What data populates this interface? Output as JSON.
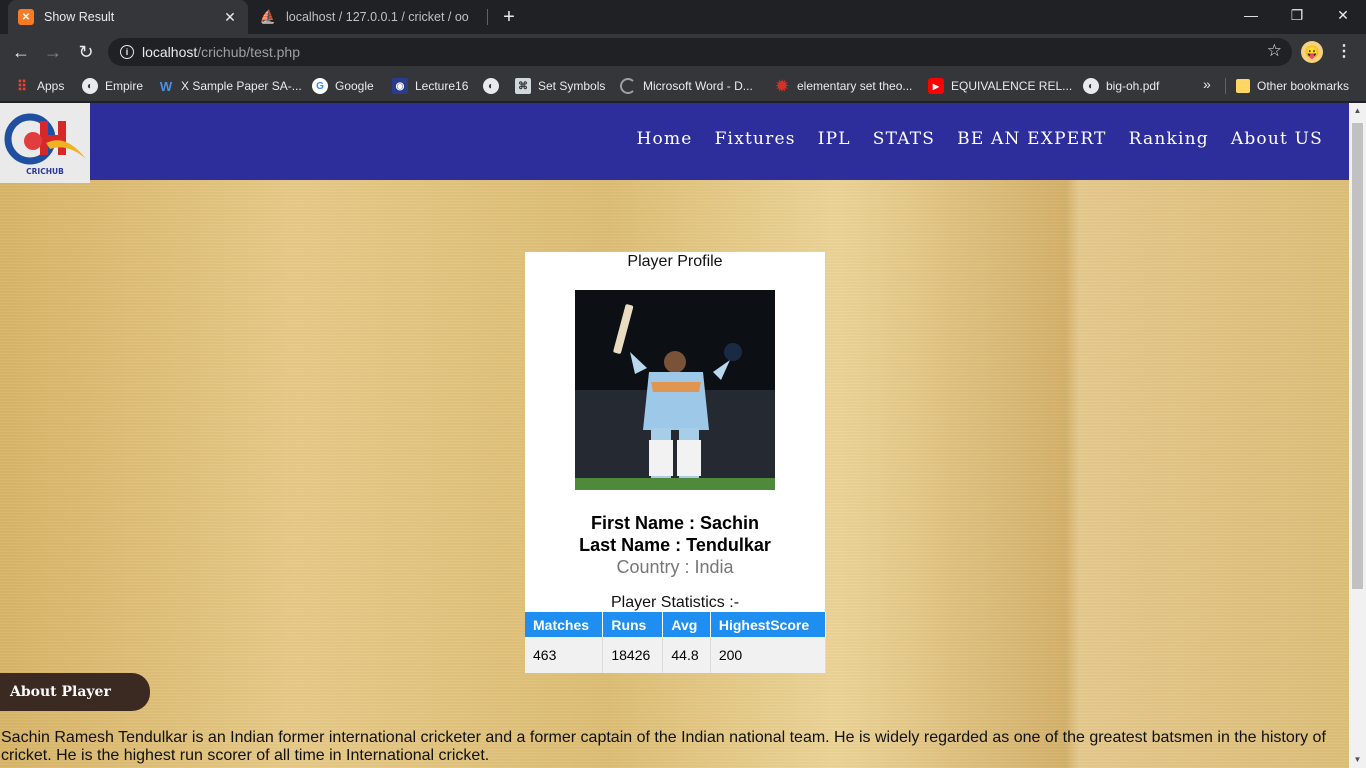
{
  "browser": {
    "tabs": [
      {
        "title": "Show Result",
        "icon": "xampp-icon",
        "active": true
      },
      {
        "title": "localhost / 127.0.0.1 / cricket / oo",
        "icon": "phpmyadmin-icon",
        "active": false
      }
    ],
    "url_host": "localhost",
    "url_path": "/crichub/test.php",
    "bookmarks": [
      {
        "label": "Apps",
        "icon": "apps-grid-icon"
      },
      {
        "label": "Empire",
        "icon": "globe-icon"
      },
      {
        "label": "X Sample Paper SA-...",
        "icon": "w-icon"
      },
      {
        "label": "Google",
        "icon": "google-icon"
      },
      {
        "label": "Lecture16",
        "icon": "lecture-icon"
      },
      {
        "label": "",
        "icon": "globe-icon"
      },
      {
        "label": "Set Symbols",
        "icon": "symbols-icon"
      },
      {
        "label": "Microsoft Word - D...",
        "icon": "loading-icon"
      },
      {
        "label": "elementary set theo...",
        "icon": "gear-red-icon"
      },
      {
        "label": "EQUIVALENCE REL...",
        "icon": "youtube-icon"
      },
      {
        "label": "big-oh.pdf",
        "icon": "globe-icon"
      }
    ],
    "other_bookmarks": "Other bookmarks"
  },
  "site": {
    "logo_text": "CRICHUB",
    "nav": [
      "Home",
      "Fixtures",
      "IPL",
      "STATS",
      "BE AN EXPERT",
      "Ranking",
      "About US"
    ]
  },
  "profile": {
    "heading": "Player Profile",
    "first_name": "First Name : Sachin",
    "last_name": "Last Name : Tendulkar",
    "country": "Country : India",
    "stats_heading": "Player Statistics :-",
    "stats_columns": [
      "Matches",
      "Runs",
      "Avg",
      "HighestScore"
    ],
    "stats_values": [
      "463",
      "18426",
      "44.8",
      "200"
    ]
  },
  "about": {
    "badge": "About Player",
    "text": "Sachin Ramesh Tendulkar is an Indian former international cricketer and a former captain of the Indian national team. He is widely regarded as one of the greatest batsmen in the history of cricket. He is the highest run scorer of all time in International cricket."
  }
}
